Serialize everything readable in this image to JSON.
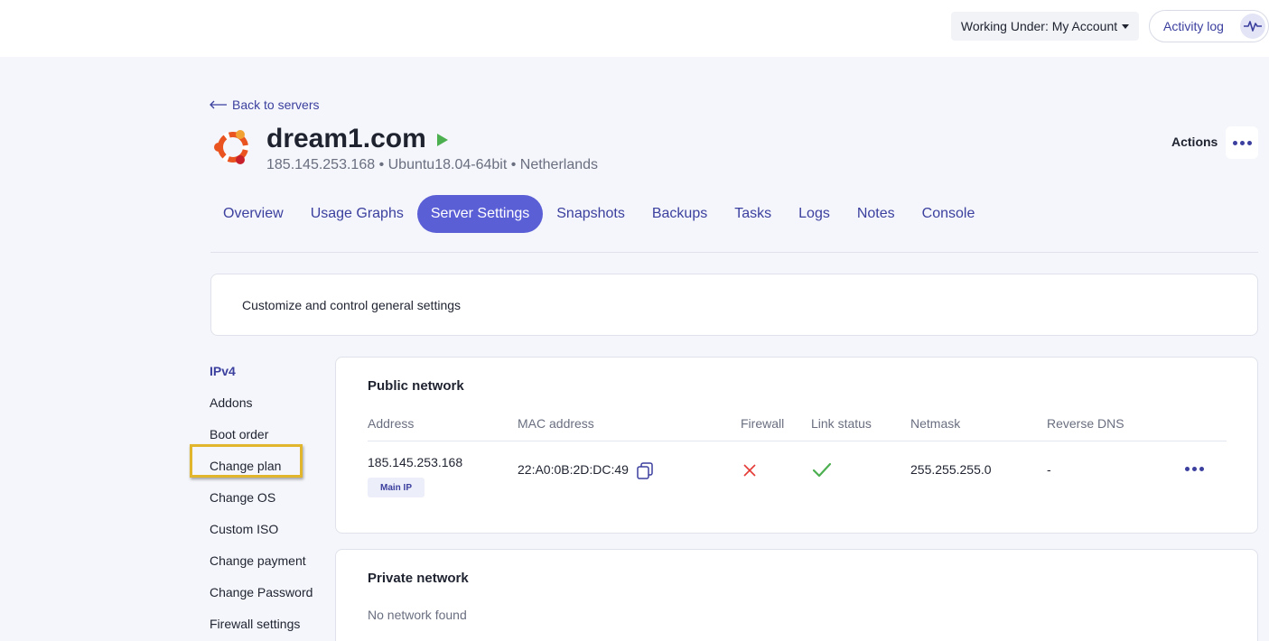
{
  "topbar": {
    "working_under": "Working Under: My Account",
    "activity_log": "Activity log"
  },
  "server": {
    "back_label": "Back to servers",
    "name": "dream1.com",
    "meta": "185.145.253.168 • Ubuntu18.04-64bit • Netherlands",
    "actions_label": "Actions",
    "os_icon": "ubuntu-logo-icon",
    "status_icon": "play-icon"
  },
  "tabs": [
    {
      "label": "Overview"
    },
    {
      "label": "Usage Graphs"
    },
    {
      "label": "Server Settings"
    },
    {
      "label": "Snapshots"
    },
    {
      "label": "Backups"
    },
    {
      "label": "Tasks"
    },
    {
      "label": "Logs"
    },
    {
      "label": "Notes"
    },
    {
      "label": "Console"
    }
  ],
  "active_tab": "Server Settings",
  "description": "Customize and control general settings",
  "sidebar": {
    "items": [
      {
        "label": "IPv4"
      },
      {
        "label": "Addons"
      },
      {
        "label": "Boot order"
      },
      {
        "label": "Change plan"
      },
      {
        "label": "Change OS"
      },
      {
        "label": "Custom ISO"
      },
      {
        "label": "Change payment"
      },
      {
        "label": "Change Password"
      },
      {
        "label": "Firewall settings"
      }
    ]
  },
  "public_network": {
    "title": "Public network",
    "headers": [
      "Address",
      "MAC address",
      "Firewall",
      "Link status",
      "Netmask",
      "Reverse DNS"
    ],
    "rows": [
      {
        "address": "185.145.253.168",
        "badge": "Main IP",
        "mac": "22:A0:0B:2D:DC:49",
        "firewall_icon": "cross-icon",
        "link_status_icon": "check-icon",
        "netmask": "255.255.255.0",
        "reverse_dns": "-"
      }
    ]
  },
  "private_network": {
    "title": "Private network",
    "empty": "No network found"
  },
  "colors": {
    "accent": "#5b5fd6",
    "link": "#3b3f9e",
    "highlight": "#e2b62c",
    "success": "#4caf50",
    "danger": "#e53935"
  }
}
